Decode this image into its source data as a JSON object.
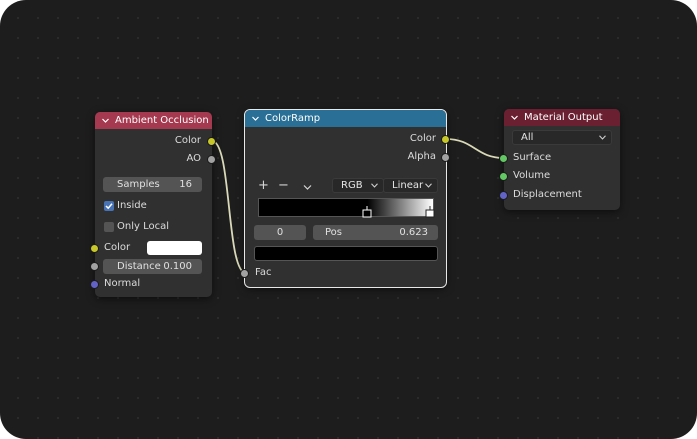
{
  "nodes": {
    "ao": {
      "title": "Ambient Occlusion",
      "header_color": "#a5394f",
      "outputs": {
        "color": "Color",
        "ao": "AO"
      },
      "samples": {
        "label": "Samples",
        "value": "16"
      },
      "inside": {
        "label": "Inside",
        "checked": true
      },
      "only_local": {
        "label": "Only Local",
        "checked": false
      },
      "inputs": {
        "color": {
          "label": "Color",
          "value_color": "#ffffff"
        },
        "distance": {
          "label": "Distance",
          "value": "0.100"
        },
        "normal": {
          "label": "Normal"
        }
      }
    },
    "colorramp": {
      "title": "ColorRamp",
      "header_color": "#2a6f95",
      "outputs": {
        "color": "Color",
        "alpha": "Alpha"
      },
      "add_icon": "+",
      "remove_icon": "−",
      "color_mode": "RGB",
      "interpolation": "Linear",
      "active_stop_index": "0",
      "pos": {
        "label": "Pos",
        "value": "0.623"
      },
      "stop_color": "#000000",
      "input": {
        "fac": "Fac"
      }
    },
    "output": {
      "title": "Material Output",
      "header_color": "#6a2030",
      "target": "All",
      "inputs": {
        "surface": "Surface",
        "volume": "Volume",
        "displacement": "Displacement"
      }
    }
  },
  "socket_colors": {
    "color": "#c7c729",
    "float": "#a1a1a1",
    "vector": "#6363c7",
    "shader": "#63c763"
  }
}
